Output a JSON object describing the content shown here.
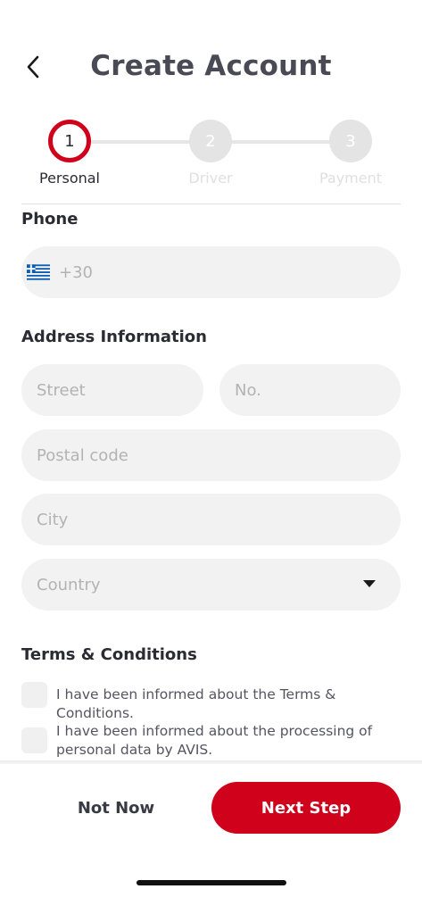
{
  "header": {
    "title": "Create Account",
    "back_icon": "chevron-left-icon"
  },
  "stepper": {
    "steps": [
      {
        "number": "1",
        "label": "Personal",
        "active": true
      },
      {
        "number": "2",
        "label": "Driver",
        "active": false
      },
      {
        "number": "3",
        "label": "Payment",
        "active": false
      }
    ],
    "active_color": "#d0021b"
  },
  "phone": {
    "title": "Phone",
    "country_code": "+30",
    "flag_icon": "greece-flag-icon"
  },
  "address": {
    "title": "Address Information",
    "street_placeholder": "Street",
    "number_placeholder": "No.",
    "postal_placeholder": "Postal code",
    "city_placeholder": "City",
    "country_placeholder": "Country"
  },
  "terms": {
    "title": "Terms & Conditions",
    "items": [
      "I have been informed about the Terms & Conditions.",
      "I have been informed about the processing of personal data by AVIS."
    ]
  },
  "footer": {
    "not_now_label": "Not Now",
    "next_step_label": "Next Step",
    "accent_color": "#d0021b"
  }
}
